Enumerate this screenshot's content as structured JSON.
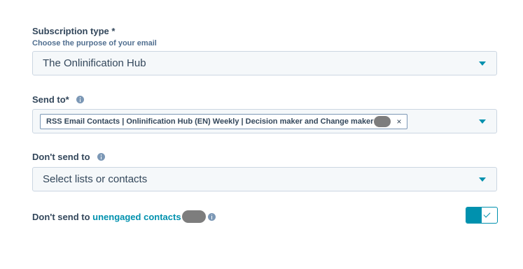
{
  "subscription": {
    "label": "Subscription type *",
    "sublabel": "Choose the purpose of your email",
    "value": "The Onlinification Hub"
  },
  "send_to": {
    "label": "Send to*",
    "tag": "RSS Email Contacts | Onlinification Hub (EN) Weekly | Decision maker and Change maker",
    "tag_remove": "×"
  },
  "dont_send_to": {
    "label": "Don't send to",
    "placeholder": "Select lists or contacts"
  },
  "unengaged": {
    "label_prefix": "Don't send to ",
    "link": "unengaged contacts",
    "toggle_on": true
  },
  "colors": {
    "accent": "#0091ae",
    "text": "#33475b",
    "field_bg": "#f5f8fa",
    "border": "#cbd6e2"
  },
  "icons": [
    "info-icon",
    "chevron-down-icon",
    "close-icon",
    "check-icon"
  ]
}
